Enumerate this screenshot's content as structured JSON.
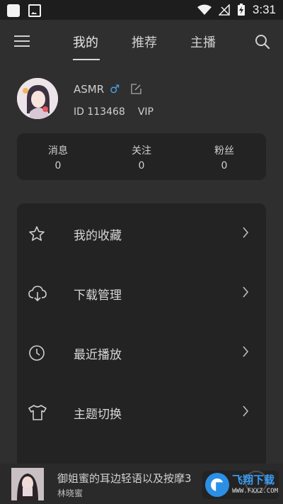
{
  "status_bar": {
    "time": "3:31"
  },
  "nav": {
    "tabs": [
      {
        "label": "我的",
        "active": true
      },
      {
        "label": "推荐",
        "active": false
      },
      {
        "label": "主播",
        "active": false
      }
    ]
  },
  "profile": {
    "username": "ASMR",
    "gender_symbol": "♂",
    "id_text": "ID 113468",
    "vip_text": "VIP"
  },
  "stats": [
    {
      "label": "消息",
      "value": "0"
    },
    {
      "label": "关注",
      "value": "0"
    },
    {
      "label": "粉丝",
      "value": "0"
    }
  ],
  "menu": [
    {
      "label": "我的收藏",
      "icon": "star-icon"
    },
    {
      "label": "下载管理",
      "icon": "cloud-download-icon"
    },
    {
      "label": "最近播放",
      "icon": "clock-icon"
    },
    {
      "label": "主题切换",
      "icon": "tshirt-icon"
    }
  ],
  "player": {
    "title": "御姐蜜的耳边轻语以及按摩3",
    "artist": "林晓蜜"
  },
  "watermark": {
    "title": "飞翔下载",
    "url": "WWW.FXXZ.COM"
  },
  "colors": {
    "background": "#2f2f2f",
    "card": "#232323",
    "gender": "#4aa3e6",
    "watermark": "#2b8fe6"
  }
}
